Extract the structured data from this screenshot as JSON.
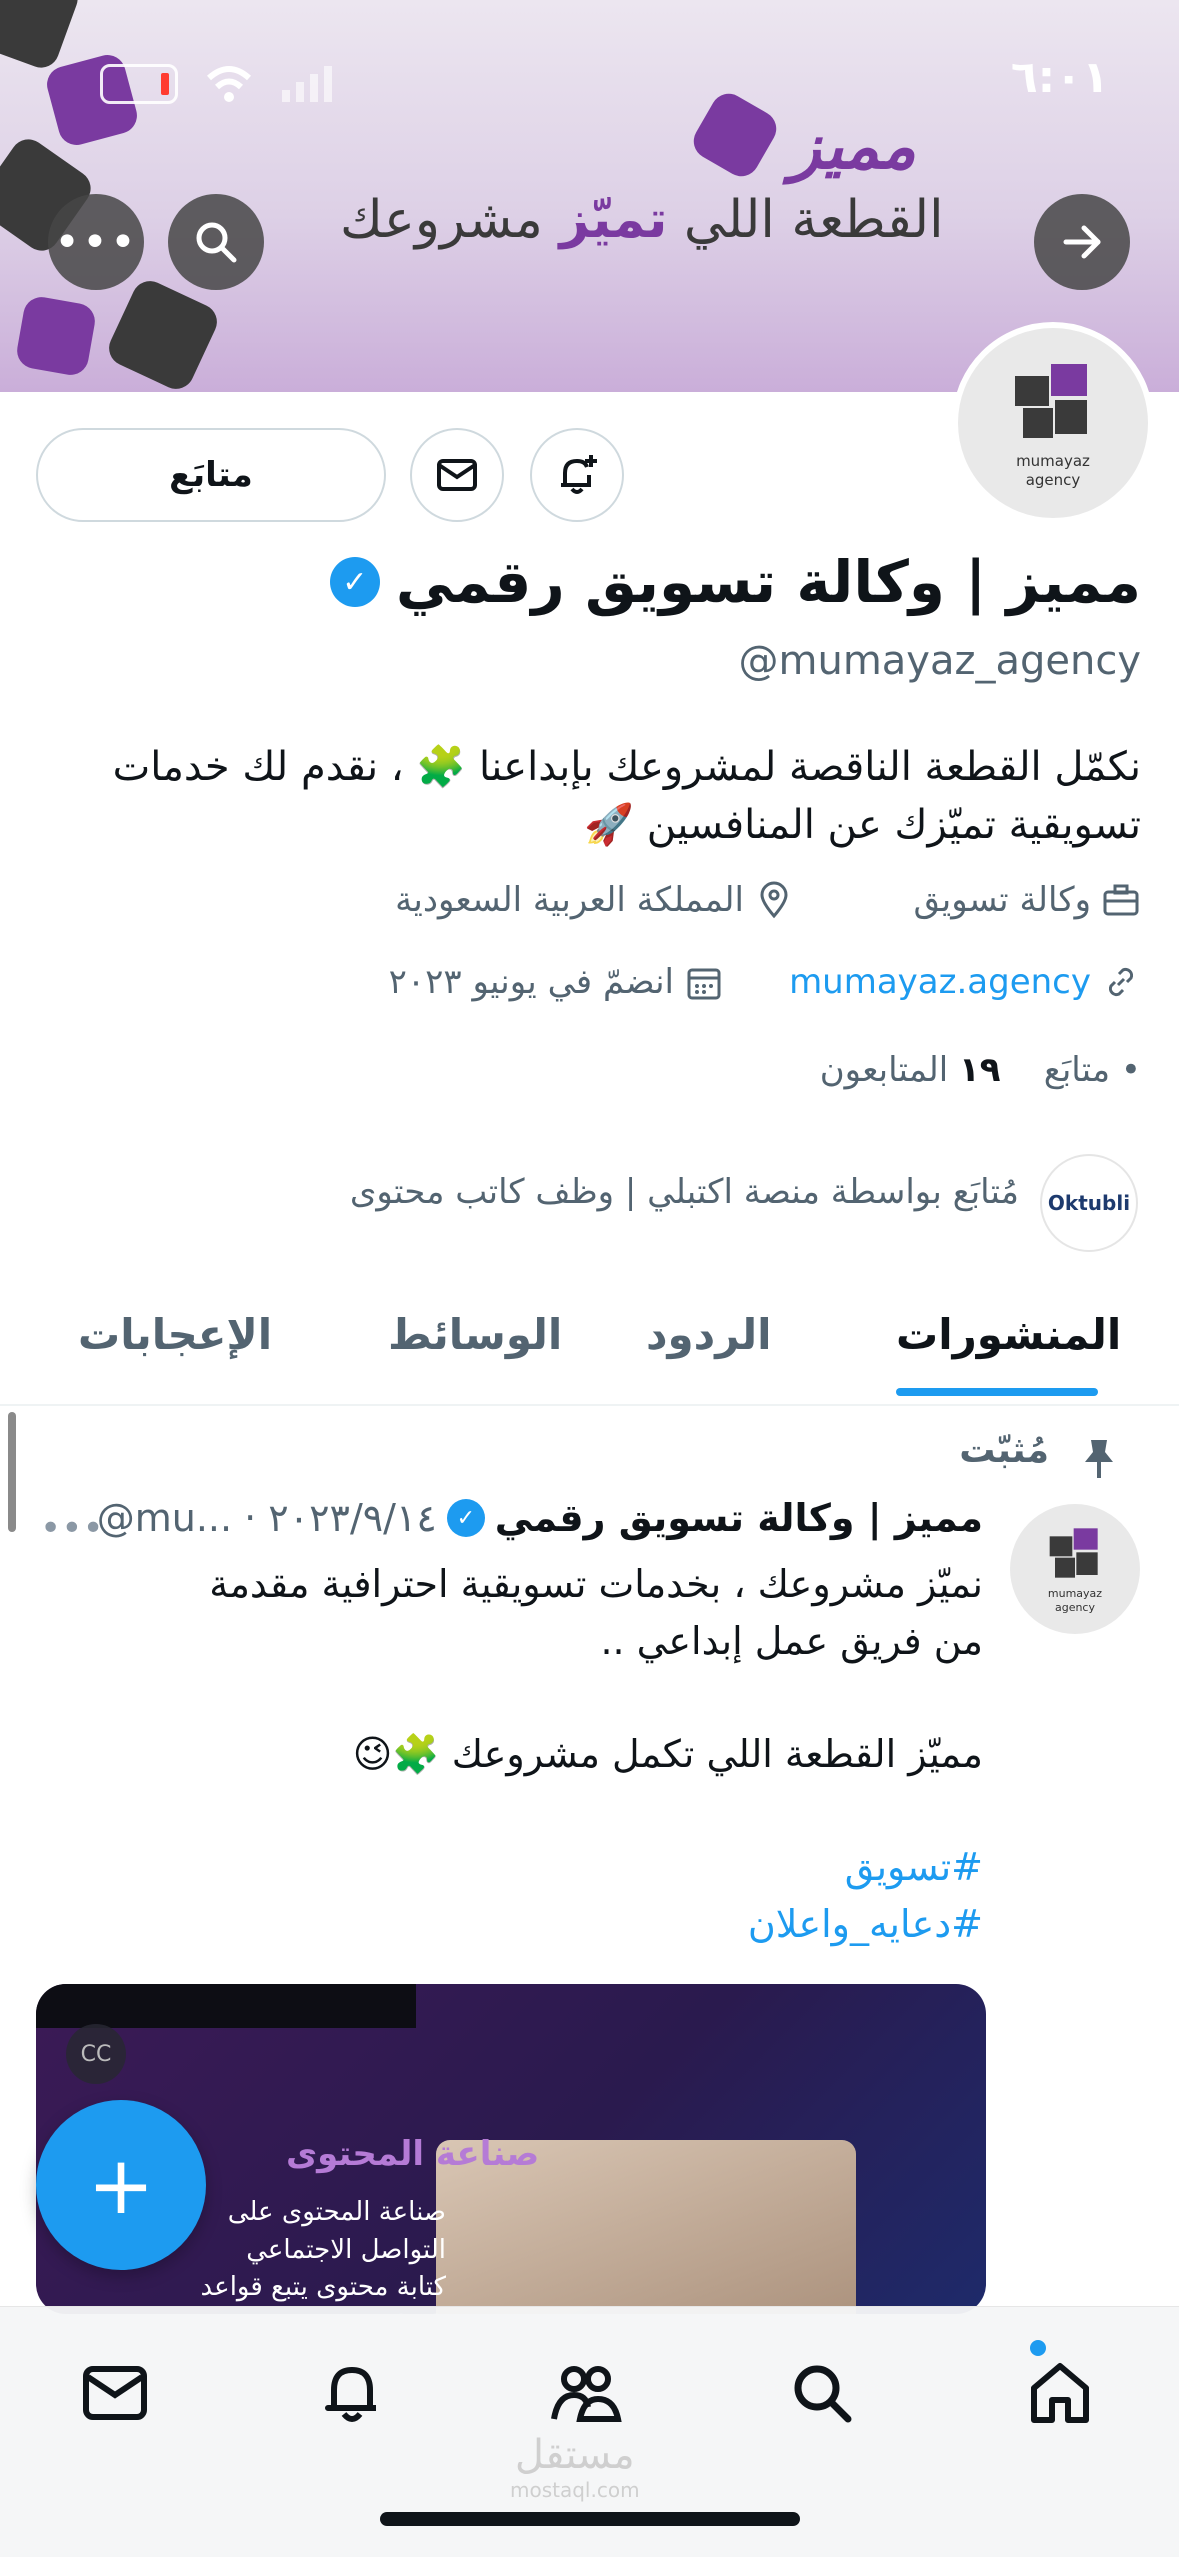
{
  "status_bar": {
    "time": "٦:٠١"
  },
  "banner": {
    "brand": "مميز",
    "tagline_part1": "القطعة اللي ",
    "tagline_highlight": "تميّز",
    "tagline_part2": " مشروعك"
  },
  "avatar": {
    "line1": "mumayaz",
    "line2": "agency"
  },
  "actions": {
    "follow_label": "متابَع"
  },
  "profile": {
    "name": "مميز | وكالة تسويق رقمي",
    "handle": "@mumayaz_agency",
    "bio": "نكمّل القطعة الناقصة لمشروعك بإبداعنا 🧩 ، نقدم لك خدمات تسويقية تميّزك عن المنافسين 🚀",
    "category": "وكالة تسويق",
    "location": "المملكة العربية السعودية",
    "website": "mumayaz.agency",
    "joined": "انضمّ في يونيو ٢٠٢٣",
    "following_label": "متابَع",
    "followers_count": "١٩",
    "followers_label": "المتابعون",
    "followed_by": "مُتابَع بواسطة منصة اكتبلي | وظف كاتب محتوى",
    "followed_by_avatar": "Oktubli"
  },
  "tabs": [
    "المنشورات",
    "الردود",
    "الوسائط",
    "الإعجابات"
  ],
  "post": {
    "pinned_label": "مُثبّت",
    "author_name": "مميز | وكالة تسويق رقمي",
    "author_meta": "@mu... · ٢٠٢٣/٩/١٤",
    "line1": "نميّز مشروعك ، بخدمات تسويقية احترافية مقدمة من فريق عمل إبداعي ..",
    "line2": "مميّز القطعة اللي تكمل مشروعك 🧩😉",
    "hashtag1": "#تسويق",
    "hashtag2": "#دعايه_واعلان",
    "media_title": "صناعة المحتوى",
    "media_sub": "صناعة المحتوى على التواصل الاجتماعي كتابة محتوى يتبع قواعد SEO"
  },
  "fab": {
    "label": "+"
  },
  "watermark": {
    "ar": "مستقل",
    "en": "mostaql.com"
  },
  "icons": [
    "battery-icon",
    "wifi-icon",
    "signal-icon",
    "more-icon",
    "search-icon",
    "arrow-right-icon",
    "bell-plus-icon",
    "mail-icon",
    "verified-icon",
    "briefcase-icon",
    "location-icon",
    "link-icon",
    "calendar-icon",
    "pin-icon",
    "home-icon",
    "people-icon",
    "notifications-icon"
  ]
}
